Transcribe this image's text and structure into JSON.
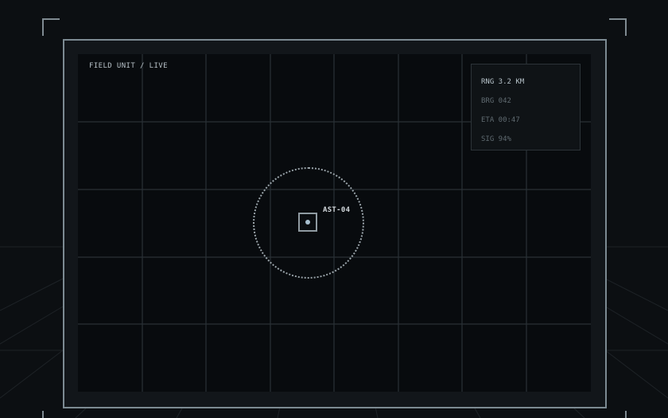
{
  "feed": {
    "label": "FIELD UNIT / LIVE"
  },
  "readouts": [
    {
      "label": "RNG 3.2 KM",
      "active": true
    },
    {
      "label": "BRG 042",
      "active": false
    },
    {
      "label": "ETA 00:47",
      "active": false
    },
    {
      "label": "SIG 94%",
      "active": false
    }
  ],
  "target": {
    "label": "AST-04"
  },
  "colors": {
    "background": "#0c0f12",
    "frame_border": "#7c8a92",
    "grid_line": "#2a3136",
    "target_dot": "#a8c0cf"
  }
}
